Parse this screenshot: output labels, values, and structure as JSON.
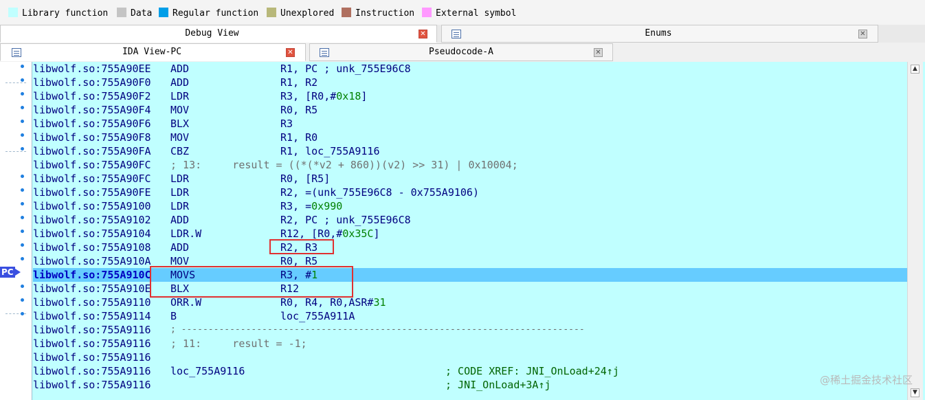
{
  "legend": [
    {
      "label": "Library function",
      "color": "#c0ffff"
    },
    {
      "label": "Data",
      "color": "#c4c4c4"
    },
    {
      "label": "Regular function",
      "color": "#009ee8"
    },
    {
      "label": "Unexplored",
      "color": "#b8b87a"
    },
    {
      "label": "Instruction",
      "color": "#b07060"
    },
    {
      "label": "External symbol",
      "color": "#ff99ff"
    }
  ],
  "tabs_top": {
    "debug_view": "Debug View",
    "enums": "Enums"
  },
  "tabs_second": {
    "ida_view": "IDA View-PC",
    "pseudocode": "Pseudocode-A"
  },
  "pc_label": "PC",
  "lines": [
    {
      "addr": "libwolf.so:755A90EE",
      "mn": "ADD",
      "op": "R1, PC ; unk_755E96C8"
    },
    {
      "addr": "libwolf.so:755A90F0",
      "mn": "ADD",
      "op": "R1, R2"
    },
    {
      "addr": "libwolf.so:755A90F2",
      "mn": "LDR",
      "op": "R3, [R0,#0x18]"
    },
    {
      "addr": "libwolf.so:755A90F4",
      "mn": "MOV",
      "op": "R0, R5"
    },
    {
      "addr": "libwolf.so:755A90F6",
      "mn": "BLX",
      "op": "R3"
    },
    {
      "addr": "libwolf.so:755A90F8",
      "mn": "MOV",
      "op": "R1, R0"
    },
    {
      "addr": "libwolf.so:755A90FA",
      "mn": "CBZ",
      "op": "R1, loc_755A9116"
    },
    {
      "addr": "libwolf.so:755A90FC",
      "comment": "; 13:     result = ((*(*v2 + 860))(v2) >> 31) | 0x10004;"
    },
    {
      "addr": "libwolf.so:755A90FC",
      "mn": "LDR",
      "op": "R0, [R5]"
    },
    {
      "addr": "libwolf.so:755A90FE",
      "mn": "LDR",
      "op": "R2, =(unk_755E96C8 - 0x755A9106)"
    },
    {
      "addr": "libwolf.so:755A9100",
      "mn": "LDR",
      "op": "R3, =0x990"
    },
    {
      "addr": "libwolf.so:755A9102",
      "mn": "ADD",
      "op": "R2, PC ; unk_755E96C8"
    },
    {
      "addr": "libwolf.so:755A9104",
      "mn": "LDR.W",
      "op": "R12, [R0,#0x35C]"
    },
    {
      "addr": "libwolf.so:755A9108",
      "mn": "ADD",
      "op": "R2, R3"
    },
    {
      "addr": "libwolf.so:755A910A",
      "mn": "MOV",
      "op": "R0, R5"
    },
    {
      "addr": "libwolf.so:755A910C",
      "mn": "MOVS",
      "op": "R3, #1",
      "current": true
    },
    {
      "addr": "libwolf.so:755A910E",
      "mn": "BLX",
      "op": "R12"
    },
    {
      "addr": "libwolf.so:755A9110",
      "mn": "ORR.W",
      "op": "R0, R4, R0,ASR#31"
    },
    {
      "addr": "libwolf.so:755A9114",
      "mn": "B",
      "op": "loc_755A911A"
    },
    {
      "addr": "libwolf.so:755A9116",
      "dashes": "; ---------------------------------------------------------------------------"
    },
    {
      "addr": "libwolf.so:755A9116",
      "comment": "; 11:     result = -1;"
    },
    {
      "addr": "libwolf.so:755A9116"
    },
    {
      "addr": "libwolf.so:755A9116",
      "mn": "loc_755A9116",
      "xref": "; CODE XREF: JNI_OnLoad+24↑j"
    },
    {
      "addr": "libwolf.so:755A9116",
      "xref": "; JNI_OnLoad+3A↑j"
    }
  ],
  "watermark": "@稀土掘金技术社区"
}
